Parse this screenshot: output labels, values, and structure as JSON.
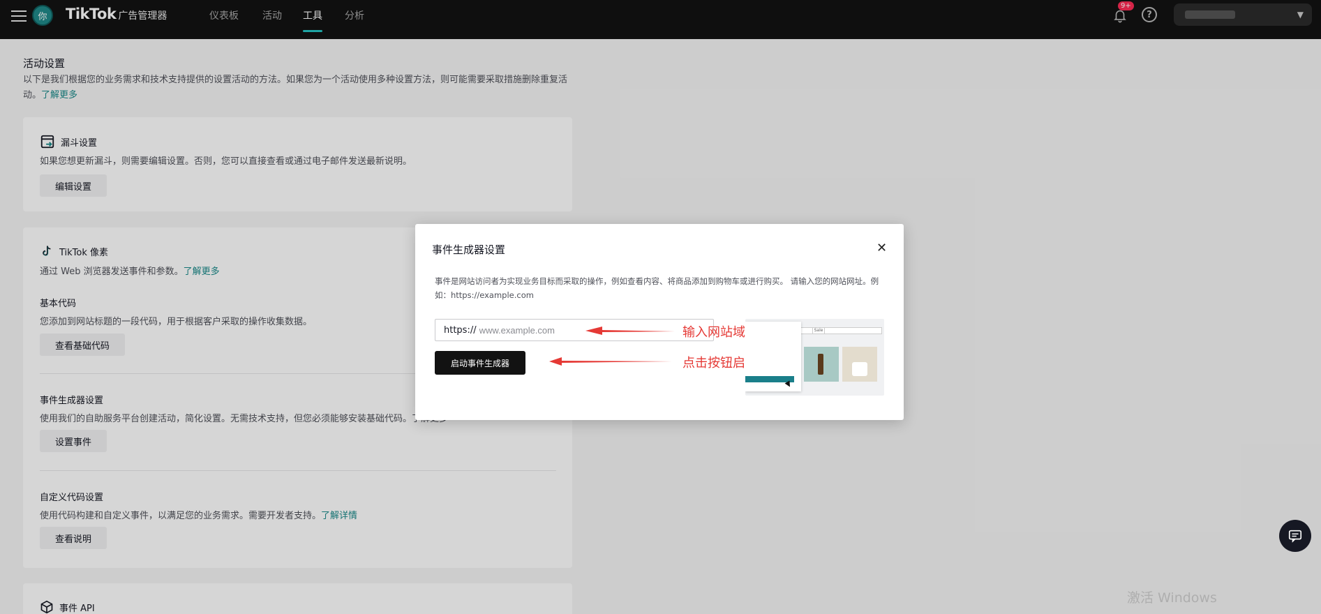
{
  "topbar": {
    "avatar_text": "你",
    "brand_logo": "TikTok",
    "brand_sub": "广告管理器",
    "tabs": [
      {
        "label": "仪表板"
      },
      {
        "label": "活动"
      },
      {
        "label": "工具"
      },
      {
        "label": "分析"
      }
    ],
    "active_tab": "工具",
    "notification_badge": "9+",
    "help_glyph": "?"
  },
  "page": {
    "title": "活动设置",
    "desc": "以下是我们根据您的业务需求和技术支持提供的设置活动的方法。如果您为一个活动使用多种设置方法，则可能需要采取措施删除重复活动。",
    "desc_link": "了解更多"
  },
  "funnel_card": {
    "title": "漏斗设置",
    "desc": "如果您想更新漏斗，则需要编辑设置。否则，您可以直接查看或通过电子邮件发送最新说明。",
    "button": "编辑设置"
  },
  "pixel_card": {
    "title": "TikTok 像素",
    "desc": "通过 Web 浏览器发送事件和参数。",
    "desc_link": "了解更多",
    "base_code": {
      "title": "基本代码",
      "desc": "您添加到网站标题的一段代码，用于根据客户采取的操作收集数据。",
      "button": "查看基础代码"
    },
    "event_builder": {
      "title": "事件生成器设置",
      "desc": "使用我们的自助服务平台创建活动，简化设置。无需技术支持，但您必须能够安装基础代码。了解更多",
      "button": "设置事件"
    },
    "custom_code": {
      "title": "自定义代码设置",
      "desc": "使用代码构建和自定义事件，以满足您的业务需求。需要开发者支持。",
      "desc_link": "了解详情",
      "button": "查看说明"
    }
  },
  "api_card": {
    "title": "事件 API"
  },
  "modal": {
    "title": "事件生成器设置",
    "close_glyph": "✕",
    "desc": "事件是网站访问者为实现业务目标而采取的操作，例如查看内容、将商品添加到购物车或进行购买。 请输入您的网站网址。例如：https://example.com",
    "url_prefix": "https://",
    "url_value": "",
    "url_placeholder": "www.example.com",
    "launch_button": "启动事件生成器",
    "annotation_url": "输入网站域名",
    "annotation_button": "点击按钮启动",
    "preview_tab_1": "ds",
    "preview_tab_2": "Sale",
    "annotation_color": "#e53935"
  },
  "watermark": "激活 Windows",
  "colors": {
    "accent": "#1a8a8a",
    "topbar": "#121212",
    "primary_button": "#121212"
  }
}
